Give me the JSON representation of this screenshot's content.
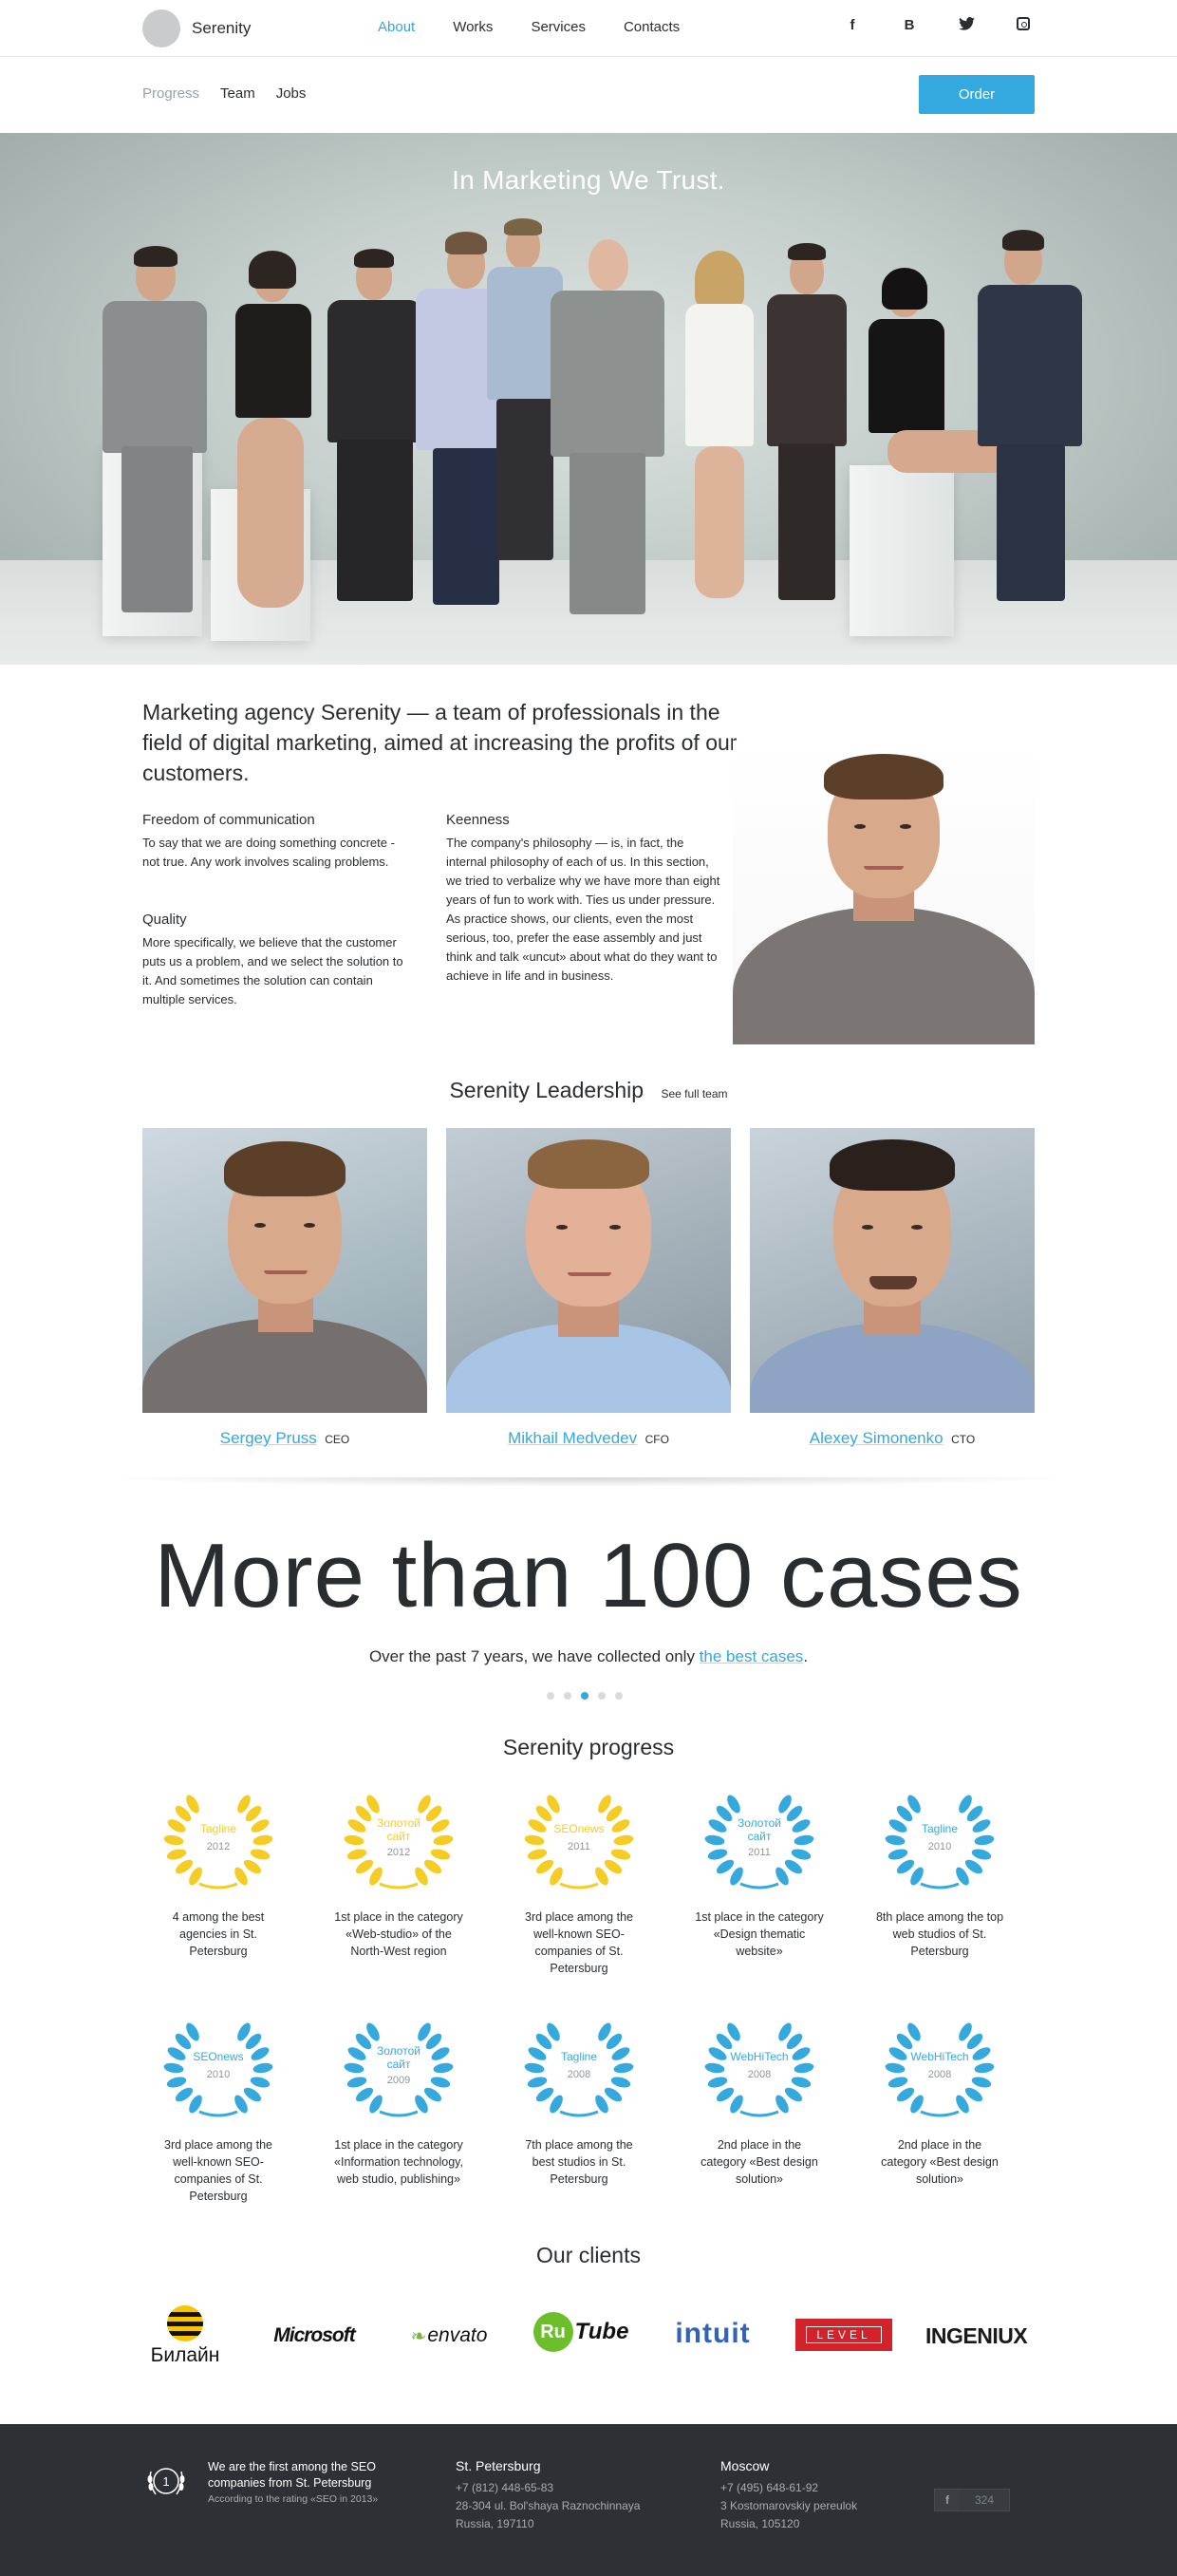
{
  "header": {
    "logo": "Serenity",
    "nav": [
      "About",
      "Works",
      "Services",
      "Contacts"
    ],
    "active_nav": "About",
    "social": [
      "f",
      "B",
      "twitter",
      "instagram"
    ]
  },
  "subnav": {
    "items": [
      "Progress",
      "Team",
      "Jobs"
    ],
    "order_button": "Order"
  },
  "hero": {
    "title": "In Marketing We Trust."
  },
  "intro": {
    "lead": "Marketing agency Serenity — a team of professionals in the field of digital marketing, aimed at increasing the profits of our customers.",
    "blocks": [
      {
        "title": "Freedom of communication",
        "text": "To say that we are doing something concrete - not true. Any work involves scaling problems."
      },
      {
        "title": "Quality",
        "text": "More specifically, we believe that the customer puts us a problem, and we select the solution to it. And sometimes the solution can contain multiple services."
      },
      {
        "title": "Keenness",
        "text": "The company's philosophy — is, in fact, the internal philosophy of each of us. In this section, we tried to verbalize why we have more than eight years of fun to work with. Ties us under pressure. As practice shows, our clients, even the most serious, too, prefer the ease assembly and just think and talk «uncut» about what do they want to achieve in life and in business."
      }
    ]
  },
  "leadership": {
    "title": "Serenity Leadership",
    "see_all": "See full team",
    "members": [
      {
        "name": "Sergey Pruss",
        "role": "CEO"
      },
      {
        "name": "Mikhail Medvedev",
        "role": "CFO"
      },
      {
        "name": "Alexey Simonenko",
        "role": "CTO"
      }
    ]
  },
  "cases": {
    "title": "More than 100 cases",
    "sub_prefix": "Over the past 7 years, we have collected only ",
    "sub_link": "the best cases",
    "sub_suffix": "."
  },
  "carousel": {
    "count": 5,
    "active_index": 2
  },
  "progress": {
    "title": "Serenity progress",
    "colors": {
      "gold": "#f5cc23",
      "blue": "#35a9de"
    },
    "awards": [
      {
        "name": "Tagline",
        "year": "2012",
        "color": "gold",
        "desc": "4 among the best agencies in St. Petersburg"
      },
      {
        "name": "Золотой сайт",
        "year": "2012",
        "color": "gold",
        "desc": "1st place in the category «Web-studio» of the North-West region"
      },
      {
        "name": "SEOnews",
        "year": "2011",
        "color": "gold",
        "desc": "3rd place among the well-known SEO-companies of St. Petersburg"
      },
      {
        "name": "Золотой сайт",
        "year": "2011",
        "color": "blue",
        "desc": "1st place in the category «Design thematic website»"
      },
      {
        "name": "Tagline",
        "year": "2010",
        "color": "blue",
        "desc": "8th place among the top web studios of St. Petersburg"
      },
      {
        "name": "SEOnews",
        "year": "2010",
        "color": "blue",
        "desc": "3rd place among the well-known SEO-companies of St. Petersburg"
      },
      {
        "name": "Золотой сайт",
        "year": "2009",
        "color": "blue",
        "desc": "1st place in the category «Information technology, web studio, publishing»"
      },
      {
        "name": "Tagline",
        "year": "2008",
        "color": "blue",
        "desc": "7th place among the best studios in St. Petersburg"
      },
      {
        "name": "WebHiTech",
        "year": "2008",
        "color": "blue",
        "desc": "2nd place in the category «Best design solution»"
      },
      {
        "name": "WebHiTech",
        "year": "2008",
        "color": "blue",
        "desc": "2nd place in the category «Best design solution»"
      }
    ]
  },
  "clients": {
    "title": "Our clients",
    "items": [
      "Билайн",
      "Microsoft",
      "envato",
      "Ru",
      "Tube",
      "intuit",
      "LEVEL",
      "INGENIUX"
    ]
  },
  "footer": {
    "badge_number": "1",
    "badge_text": "We are the first among the SEO companies from St. Petersburg",
    "badge_note": "According to the rating «SEO in 2013»",
    "offices": [
      {
        "city": "St. Petersburg",
        "lines": [
          "+7 (812) 448-65-83",
          "28-304 ul. Bol'shaya Raznochinnaya",
          "Russia, 197110"
        ]
      },
      {
        "city": "Moscow",
        "lines": [
          "+7 (495) 648-61-92",
          "3 Kostomarovskiy pereulok",
          "Russia, 105120"
        ]
      }
    ],
    "like_label": "f",
    "like_count": "324"
  }
}
